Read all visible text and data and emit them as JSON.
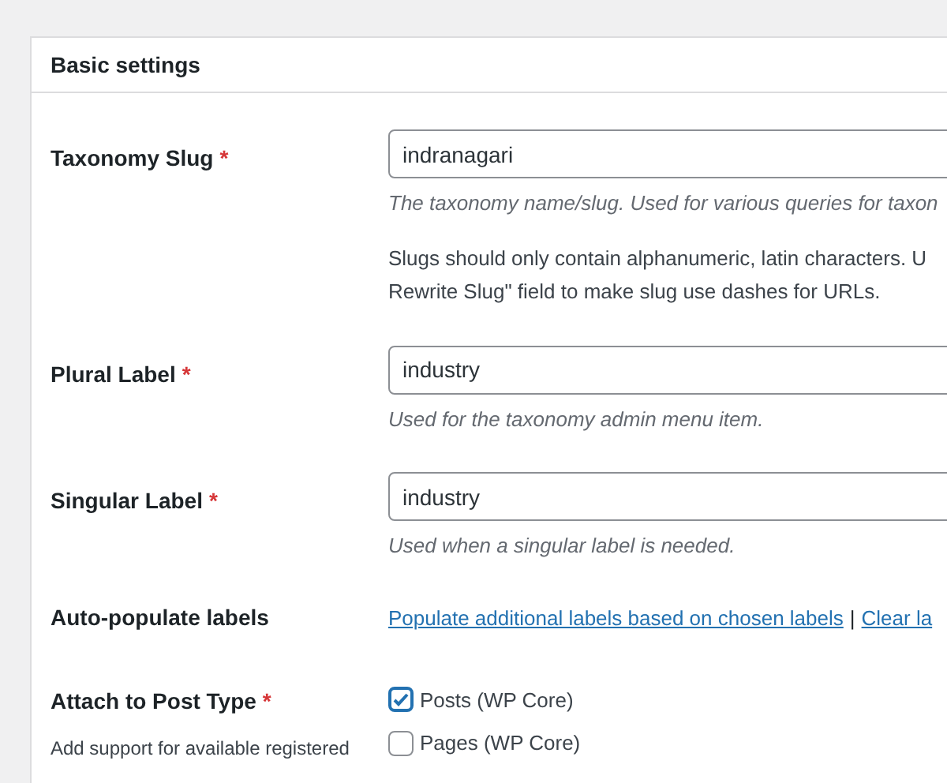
{
  "panel": {
    "title": "Basic settings"
  },
  "fields": [
    {
      "label": "Taxonomy Slug",
      "required": true,
      "required_mark": "*",
      "value": "indranagari",
      "description": "The taxonomy name/slug. Used for various queries for taxon",
      "notes": [
        "Slugs should only contain alphanumeric, latin characters. U",
        "Rewrite Slug\" field to make slug use dashes for URLs."
      ]
    },
    {
      "label": "Plural Label",
      "required": true,
      "required_mark": "*",
      "value": "industry",
      "description": "Used for the taxonomy admin menu item."
    },
    {
      "label": "Singular Label",
      "required": true,
      "required_mark": "*",
      "value": "industry",
      "description": "Used when a singular label is needed."
    }
  ],
  "auto_populate": {
    "label": "Auto-populate labels",
    "links": [
      "Populate additional labels based on chosen labels",
      "Clear la"
    ],
    "separator": "|"
  },
  "attach": {
    "label": "Attach to Post Type",
    "required": true,
    "required_mark": "*",
    "help": "Add support for available registered",
    "options": [
      {
        "label": "Posts (WP Core)",
        "checked": true
      },
      {
        "label": "Pages (WP Core)",
        "checked": false
      }
    ]
  }
}
